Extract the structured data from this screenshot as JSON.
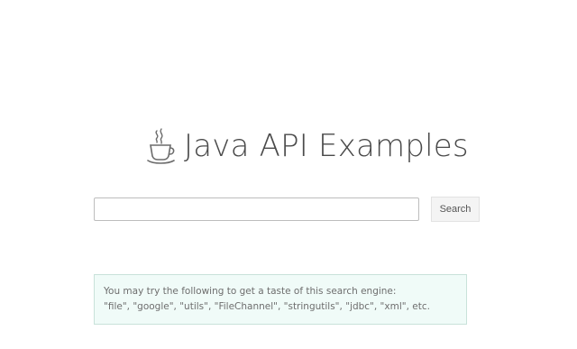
{
  "header": {
    "title": "Java API Examples",
    "icon": "coffee-cup-icon"
  },
  "search": {
    "value": "",
    "placeholder": "",
    "button_label": "Search"
  },
  "hint": {
    "line1": "You may try the following to get a taste of this search engine:",
    "line2": "\"file\", \"google\", \"utils\", \"FileChannel\", \"stringutils\", \"jdbc\", \"xml\", etc."
  },
  "colors": {
    "title_text": "#4a4a4a",
    "hint_background": "#f0fbf8",
    "hint_border": "#c9e2da",
    "button_background": "#f4f4f4"
  }
}
